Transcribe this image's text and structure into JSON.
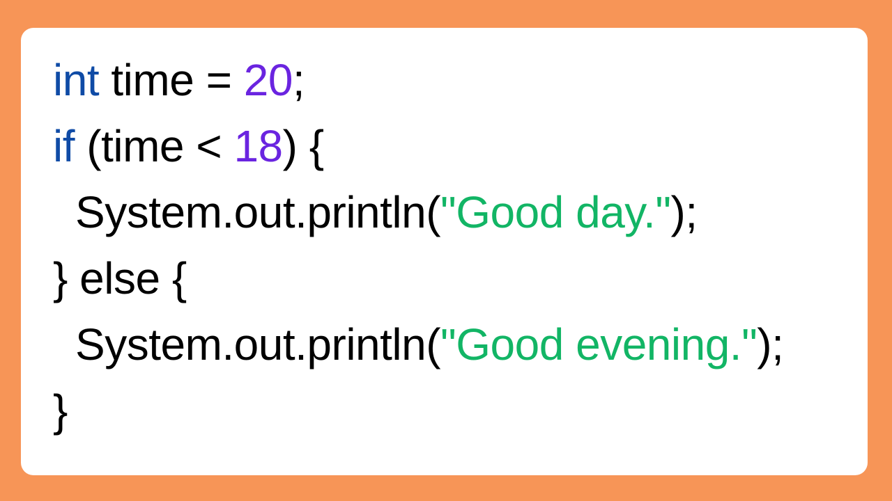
{
  "colors": {
    "background": "#f79557",
    "card": "#ffffff",
    "keyword": "#0f4ba6",
    "number": "#6a24e0",
    "string": "#12b565",
    "plain": "#000000"
  },
  "code": {
    "line1": {
      "kw": "int",
      "a": " time = ",
      "num": "20",
      "b": ";"
    },
    "line2": {
      "kw": "if",
      "a": " (time < ",
      "num": "18",
      "b": ") {"
    },
    "line3": {
      "a": "System.out.println(",
      "str": "\"Good day.\"",
      "b": ");"
    },
    "line4": {
      "a": "} else {"
    },
    "line5": {
      "a": "System.out.println(",
      "str": "\"Good evening.\"",
      "b": ");"
    },
    "line6": {
      "a": "}"
    }
  }
}
